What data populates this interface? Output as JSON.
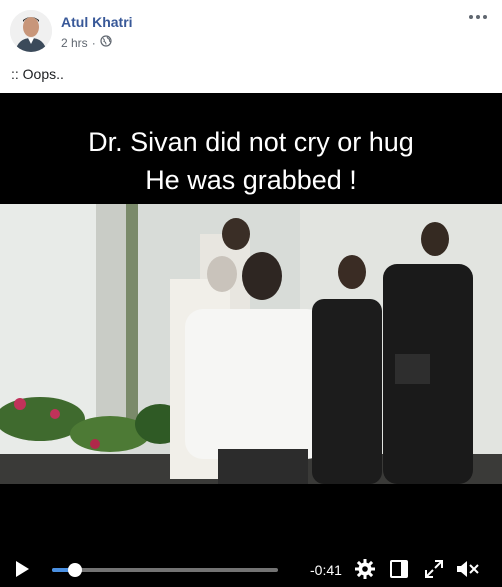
{
  "post": {
    "author": "Atul Khatri",
    "time": "2 hrs",
    "separator": "·",
    "caption": ":: Oops.."
  },
  "video": {
    "overlay_line1": "Dr. Sivan did not cry or hug",
    "overlay_line2": "He was grabbed !",
    "time_remaining": "-0:41",
    "progress": 0.1
  },
  "icons": {
    "more": "more-options-icon",
    "audience": "globe-icon",
    "play": "play-icon",
    "settings": "gear-icon",
    "pip": "picture-in-picture-icon",
    "fullscreen": "fullscreen-icon",
    "volume": "volume-muted-icon"
  },
  "colors": {
    "author_link": "#385898",
    "progress_fill": "#4a90e2"
  }
}
